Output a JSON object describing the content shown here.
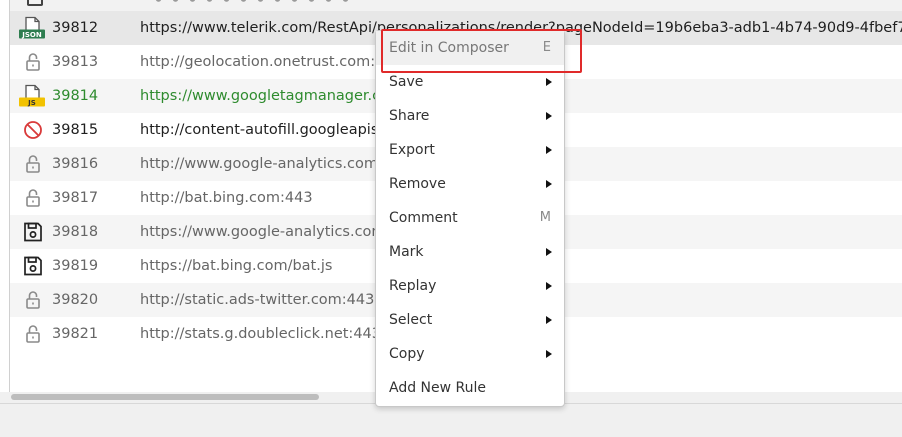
{
  "sessions": [
    {
      "id": "39812",
      "url": "https://www.telerik.com/RestApi/personalizations/render?pageNodeId=19b6eba3-adb1-4b74-90d9-4fbef7",
      "icon": "json-file-icon",
      "icon_label": "JSON",
      "style": "dark",
      "selected": true
    },
    {
      "id": "39813",
      "url": "http://geolocation.onetrust.com:443",
      "icon": "lock-icon",
      "style": "normal"
    },
    {
      "id": "39814",
      "url": "https://www.googletagmanager.com",
      "icon": "js-file-icon",
      "icon_label": "JS",
      "style": "green"
    },
    {
      "id": "39815",
      "url": "http://content-autofill.googleapis.com:443",
      "icon": "blocked-icon",
      "style": "dark"
    },
    {
      "id": "39816",
      "url": "http://www.google-analytics.com:443",
      "icon": "lock-icon",
      "style": "normal"
    },
    {
      "id": "39817",
      "url": "http://bat.bing.com:443",
      "icon": "lock-icon",
      "style": "normal"
    },
    {
      "id": "39818",
      "url": "https://www.google-analytics.com",
      "icon": "save-disk-icon",
      "style": "normal"
    },
    {
      "id": "39819",
      "url": "https://bat.bing.com/bat.js",
      "icon": "save-disk-icon",
      "style": "normal"
    },
    {
      "id": "39820",
      "url": "http://static.ads-twitter.com:443",
      "icon": "lock-icon",
      "style": "normal"
    },
    {
      "id": "39821",
      "url": "http://stats.g.doubleclick.net:443",
      "icon": "lock-icon",
      "style": "normal"
    }
  ],
  "context_menu": {
    "items": [
      {
        "label": "Edit in Composer",
        "shortcut": "E",
        "submenu": false
      },
      {
        "label": "Save",
        "shortcut": "",
        "submenu": true
      },
      {
        "label": "Share",
        "shortcut": "",
        "submenu": true
      },
      {
        "label": "Export",
        "shortcut": "",
        "submenu": true
      },
      {
        "label": "Remove",
        "shortcut": "",
        "submenu": true
      },
      {
        "label": "Comment",
        "shortcut": "M",
        "submenu": false
      },
      {
        "label": "Mark",
        "shortcut": "",
        "submenu": true
      },
      {
        "label": "Replay",
        "shortcut": "",
        "submenu": true
      },
      {
        "label": "Select",
        "shortcut": "",
        "submenu": true
      },
      {
        "label": "Copy",
        "shortcut": "",
        "submenu": true
      },
      {
        "label": "Add New Rule",
        "shortcut": "",
        "submenu": false
      }
    ]
  },
  "colors": {
    "highlight_box": "#e02a2a",
    "green_text": "#2e8b2e",
    "json_badge": "#2e7d4f",
    "js_badge": "#f2c200",
    "blocked_red": "#d93a3a"
  }
}
